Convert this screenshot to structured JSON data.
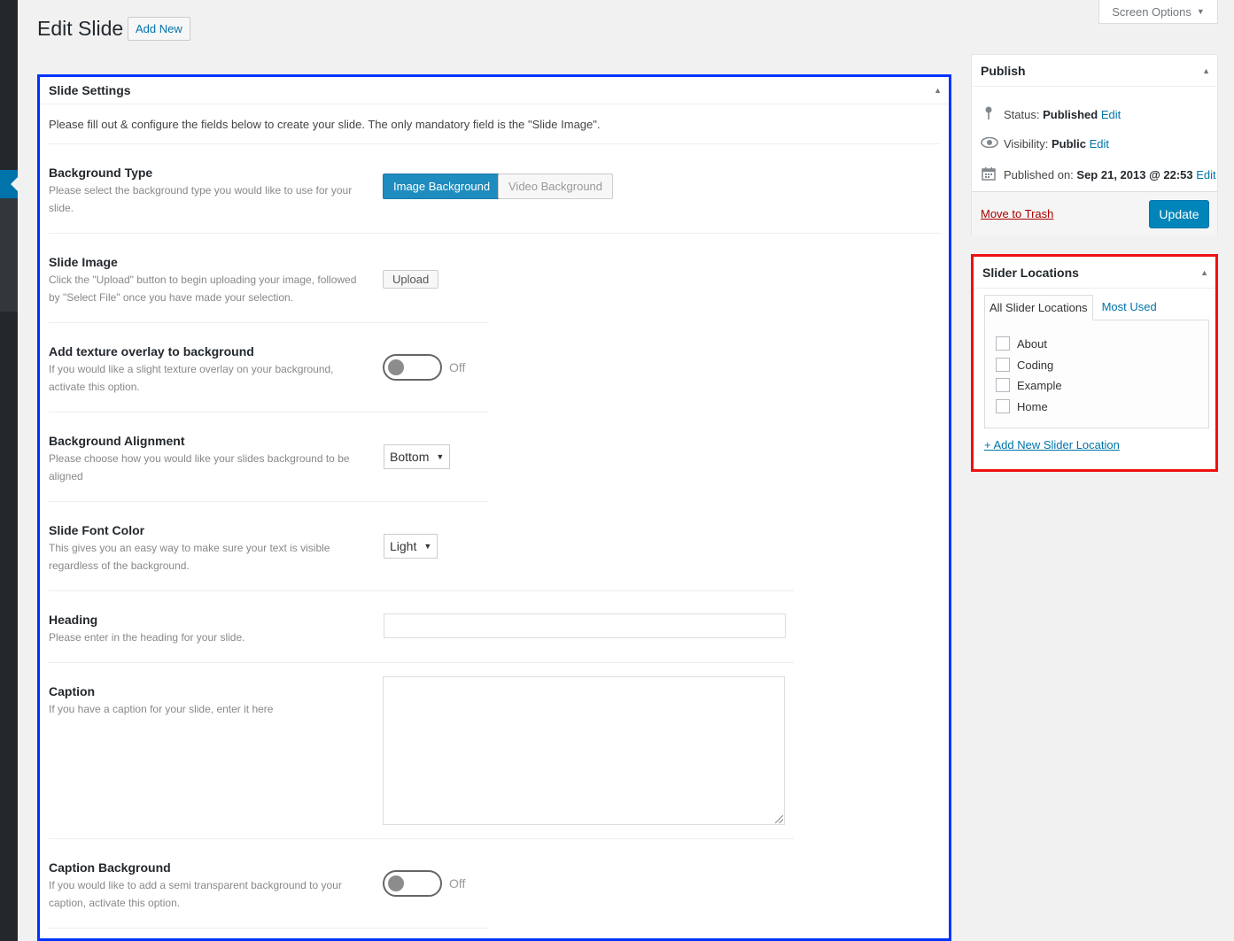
{
  "screen_options": {
    "label": "Screen Options"
  },
  "page": {
    "title": "Edit Slide",
    "add_new": "Add New"
  },
  "slide_settings": {
    "title": "Slide Settings",
    "intro": "Please fill out & configure the fields below to create your slide. The only mandatory field is the \"Slide Image\".",
    "fields": {
      "background_type": {
        "label": "Background Type",
        "desc": "Please select the background type you would like to use for your slide.",
        "options": [
          "Image Background",
          "Video Background"
        ],
        "selected": "Image Background"
      },
      "slide_image": {
        "label": "Slide Image",
        "desc": "Click the \"Upload\" button to begin uploading your image, followed by \"Select File\" once you have made your selection.",
        "button": "Upload"
      },
      "texture_overlay": {
        "label": "Add texture overlay to background",
        "desc": "If you would like a slight texture overlay on your background, activate this option.",
        "state": "Off"
      },
      "background_alignment": {
        "label": "Background Alignment",
        "desc": "Please choose how you would like your slides background to be aligned",
        "value": "Bottom"
      },
      "font_color": {
        "label": "Slide Font Color",
        "desc": "This gives you an easy way to make sure your text is visible regardless of the background.",
        "value": "Light"
      },
      "heading": {
        "label": "Heading",
        "desc": "Please enter in the heading for your slide.",
        "value": ""
      },
      "caption": {
        "label": "Caption",
        "desc": "If you have a caption for your slide, enter it here",
        "value": ""
      },
      "caption_background": {
        "label": "Caption Background",
        "desc": "If you would like to add a semi transparent background to your caption, activate this option.",
        "state": "Off"
      }
    }
  },
  "publish": {
    "title": "Publish",
    "status_label": "Status:",
    "status_value": "Published",
    "visibility_label": "Visibility:",
    "visibility_value": "Public",
    "published_label": "Published on:",
    "published_value": "Sep 21, 2013 @ 22:53",
    "edit": "Edit",
    "trash": "Move to Trash",
    "update": "Update"
  },
  "slider_locations": {
    "title": "Slider Locations",
    "tabs": [
      "All Slider Locations",
      "Most Used"
    ],
    "items": [
      "About",
      "Coding",
      "Example",
      "Home"
    ],
    "add_new": "+ Add New Slider Location"
  },
  "colors": {
    "accent": "#0073aa",
    "primary_button": "#0085ba",
    "highlight_main": "#0033ff",
    "highlight_side": "#ee1111"
  }
}
